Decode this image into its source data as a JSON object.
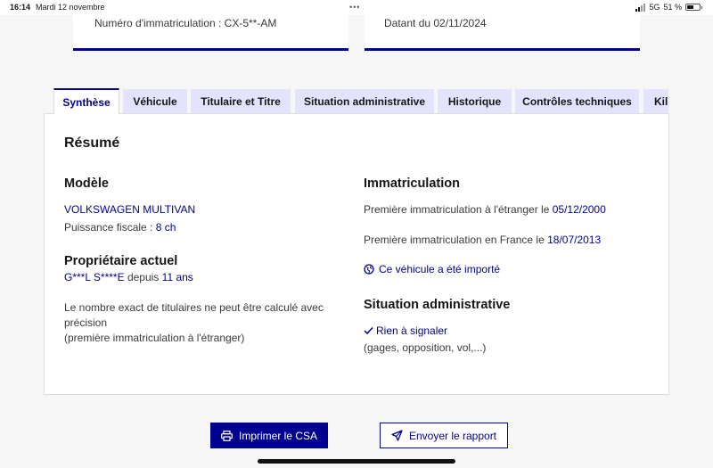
{
  "statusbar": {
    "time": "16:14",
    "date": "Mardi 12 novembre",
    "network": "5G",
    "battery_text": "51 %",
    "battery_level": 0.51
  },
  "cards": {
    "registration": "Numéro d'immatriculation : CX-5**-AM",
    "dated": "Datant du 02/11/2024"
  },
  "tabs": [
    {
      "label": "Synthèse",
      "active": true
    },
    {
      "label": "Véhicule"
    },
    {
      "label": "Titulaire et Titre"
    },
    {
      "label": "Situation administrative"
    },
    {
      "label": "Historique"
    },
    {
      "label": "Contrôles techniques"
    },
    {
      "label": "Kilo"
    }
  ],
  "summary": {
    "title": "Résumé",
    "model": {
      "heading": "Modèle",
      "name": "VOLKSWAGEN MULTIVAN",
      "power_label": "Puissance fiscale :",
      "power_value": "8 ch"
    },
    "owner": {
      "heading": "Propriétaire actuel",
      "name": "G***L S****E",
      "since_label": "depuis",
      "since_value": "11 ans",
      "note_line1": "Le nombre exact de titulaires ne peut être calculé avec",
      "note_line2": "précision",
      "note_line3": "(première immatriculation à l'étranger)"
    },
    "registration": {
      "heading": "Immatriculation",
      "foreign_label": "Première immatriculation à l'étranger le",
      "foreign_date": "05/12/2000",
      "france_label": "Première immatriculation en France le",
      "france_date": "18/07/2013",
      "imported_link": "Ce véhicule a été importé"
    },
    "admin": {
      "heading": "Situation administrative",
      "status_link": "Rien à signaler",
      "details": "(gages, opposition, vol,...)"
    }
  },
  "actions": {
    "print": "Imprimer le CSA",
    "send": "Envoyer le rapport"
  },
  "colors": {
    "primary": "#000091",
    "tab_bg": "#e3e3fd",
    "page_bg": "#f6f6f6"
  }
}
